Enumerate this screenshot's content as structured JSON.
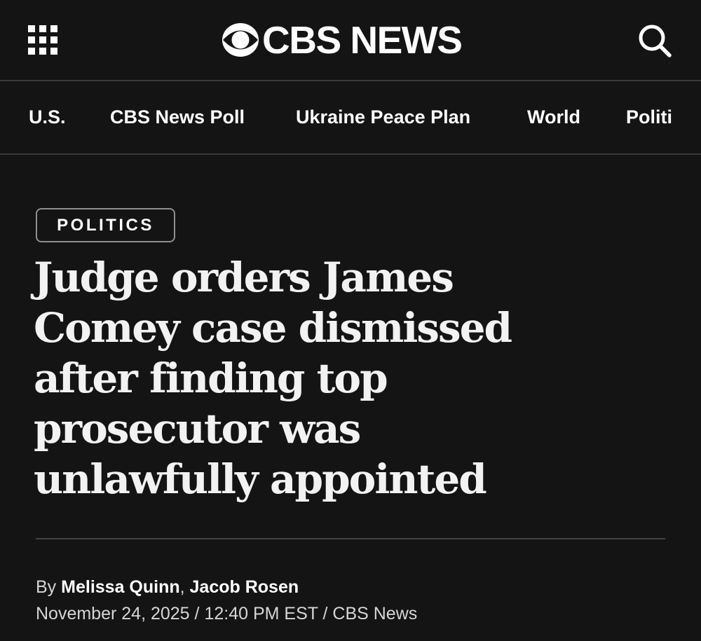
{
  "header": {
    "menu_icon": "grid-menu-icon",
    "logo_icon": "cbs-eye-icon",
    "logo_text": "CBS NEWS",
    "search_icon": "search-icon"
  },
  "nav": {
    "items": [
      {
        "label": "U.S."
      },
      {
        "label": "CBS News Poll"
      },
      {
        "label": "Ukraine Peace Plan"
      },
      {
        "label": "World"
      },
      {
        "label": "Politics"
      }
    ]
  },
  "article": {
    "category": "POLITICS",
    "headline": "Judge orders James Comey case dismissed after finding top prosecutor was unlawfully appointed",
    "by_prefix": "By",
    "authors": [
      "Melissa Quinn",
      "Jacob Rosen"
    ],
    "author_separator": ",",
    "date": "November 24, 2025",
    "time": "12:40 PM EST",
    "source": "CBS News",
    "meta_separator": " / "
  },
  "colors": {
    "background": "#141414",
    "text": "#ffffff",
    "muted_text": "#d6d6d6",
    "divider": "#3a3a3a",
    "badge_border": "#8f8f8f"
  }
}
